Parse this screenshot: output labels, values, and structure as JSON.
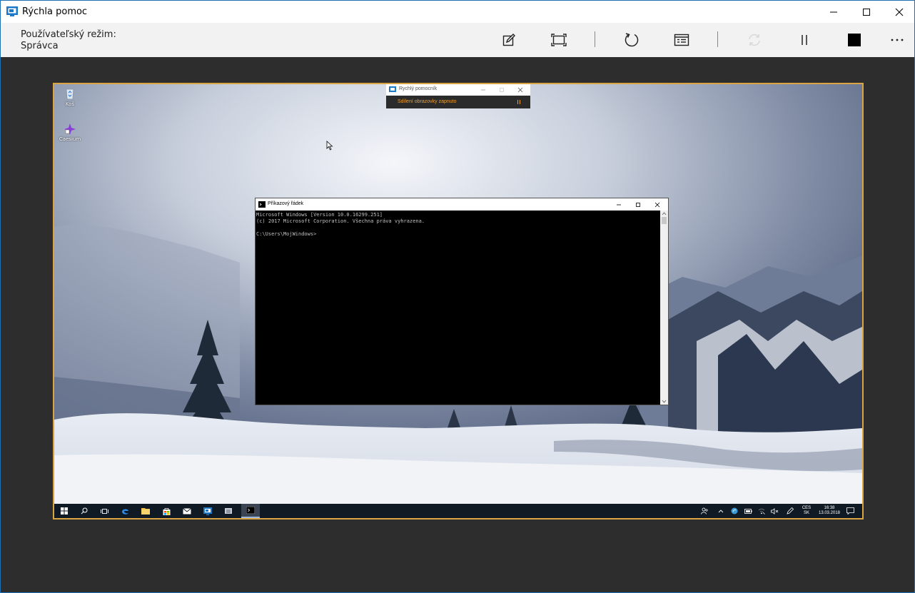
{
  "window": {
    "title": "Rýchla pomoc"
  },
  "toolbar": {
    "mode_label": "Používateľský režim:",
    "mode_value": "Správca",
    "buttons": [
      "annotate-icon",
      "fit-screen-icon",
      "restart-icon",
      "task-manager-icon",
      "reconnect-icon",
      "pause-icon",
      "stop-icon",
      "more-icon"
    ]
  },
  "remote": {
    "desktop_icons": [
      {
        "label": "Koš",
        "icon": "recycle-bin-icon"
      },
      {
        "label": "Caesium",
        "icon": "caesium-app-icon"
      }
    ],
    "mini_assist": {
      "title": "Rychlý pomocník",
      "status": "Sdílení obrazovky zapnuto"
    },
    "cmd": {
      "title": "Příkazový řádek",
      "lines": [
        "Microsoft Windows [Version 10.0.16299.251]",
        "(c) 2017 Microsoft Corporation. Všechna práva vyhrazena.",
        "",
        "C:\\Users\\MojWindows>"
      ]
    },
    "taskbar": {
      "lang_top": "CES",
      "lang_bottom": "SK",
      "time": "16:38",
      "date": "13.03.2018"
    }
  },
  "colors": {
    "accent_border": "#d9a441",
    "status_orange": "#f0a030",
    "taskbar": "#101a24"
  }
}
